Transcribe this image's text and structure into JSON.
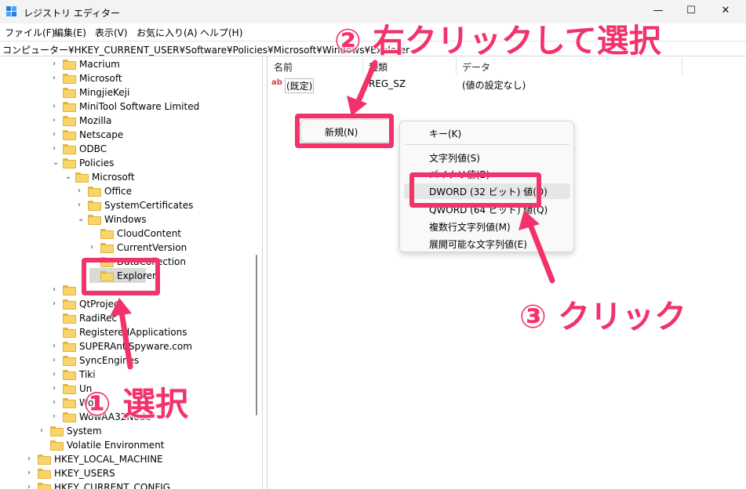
{
  "window": {
    "title": "レジストリ エディター",
    "minimize": "—",
    "maximize": "☐",
    "close": "✕"
  },
  "menu": [
    "ファイル(F)",
    "編集(E)",
    "表示(V)",
    "お気に入り(A)",
    "ヘルプ(H)"
  ],
  "address": "コンピューター¥HKEY_CURRENT_USER¥Software¥Policies¥Microsoft¥Windows¥Explorer",
  "tree": [
    {
      "label": "Macrium",
      "expander": "›"
    },
    {
      "label": "Microsoft",
      "expander": "›"
    },
    {
      "label": "MingjieKeji",
      "expander": ""
    },
    {
      "label": "MiniTool Software Limited",
      "expander": "›"
    },
    {
      "label": "Mozilla",
      "expander": "›"
    },
    {
      "label": "Netscape",
      "expander": "›"
    },
    {
      "label": "ODBC",
      "expander": "›"
    },
    {
      "label": "Policies",
      "expander": "⌄"
    },
    {
      "label": "Microsoft",
      "expander": "⌄"
    },
    {
      "label": "Office",
      "expander": "›"
    },
    {
      "label": "SystemCertificates",
      "expander": "›"
    },
    {
      "label": "Windows",
      "expander": "⌄"
    },
    {
      "label": "CloudContent",
      "expander": ""
    },
    {
      "label": "CurrentVersion",
      "expander": "›"
    },
    {
      "label": "DataCollection",
      "expander": ""
    },
    {
      "label": "Explorer",
      "expander": ""
    },
    {
      "label": "",
      "expander": "›"
    },
    {
      "label": "QtProject",
      "expander": "›"
    },
    {
      "label": "RadiRec",
      "expander": ""
    },
    {
      "label": "RegisteredApplications",
      "expander": ""
    },
    {
      "label": "SUPERAntiSpyware.com",
      "expander": "›"
    },
    {
      "label": "SyncEngines",
      "expander": "›"
    },
    {
      "label": "Tiki",
      "expander": "›"
    },
    {
      "label": "Un",
      "expander": "›"
    },
    {
      "label": "Wo",
      "expander": "›"
    },
    {
      "label": "WowAA32Node",
      "expander": "›"
    },
    {
      "label": "System",
      "expander": "›"
    },
    {
      "label": "Volatile Environment",
      "expander": ""
    },
    {
      "label": "HKEY_LOCAL_MACHINE",
      "expander": "›"
    },
    {
      "label": "HKEY_USERS",
      "expander": "›"
    },
    {
      "label": "HKEY_CURRENT_CONFIG",
      "expander": "›"
    }
  ],
  "list": {
    "columns": [
      "名前",
      "種類",
      "データ"
    ],
    "rows": [
      {
        "icon": "ab",
        "name": "(既定)",
        "type": "REG_SZ",
        "data": "(値の設定なし)"
      }
    ]
  },
  "context_menu": {
    "new_label": "新規(N)"
  },
  "submenu": {
    "items": [
      "キー(K)",
      "文字列値(S)",
      "バイナリ値(B)",
      "DWORD (32 ビット) 値(D)",
      "QWORD (64 ビット) 値(Q)",
      "複数行文字列値(M)",
      "展開可能な文字列値(E)"
    ]
  },
  "annotations": {
    "step1": "① 選択",
    "step2": "② 右クリックして選択",
    "step3": "③ クリック"
  },
  "colors": {
    "annotation": "#f2336b",
    "folder": "#f9d46a",
    "selection": "#d9d9d9"
  }
}
